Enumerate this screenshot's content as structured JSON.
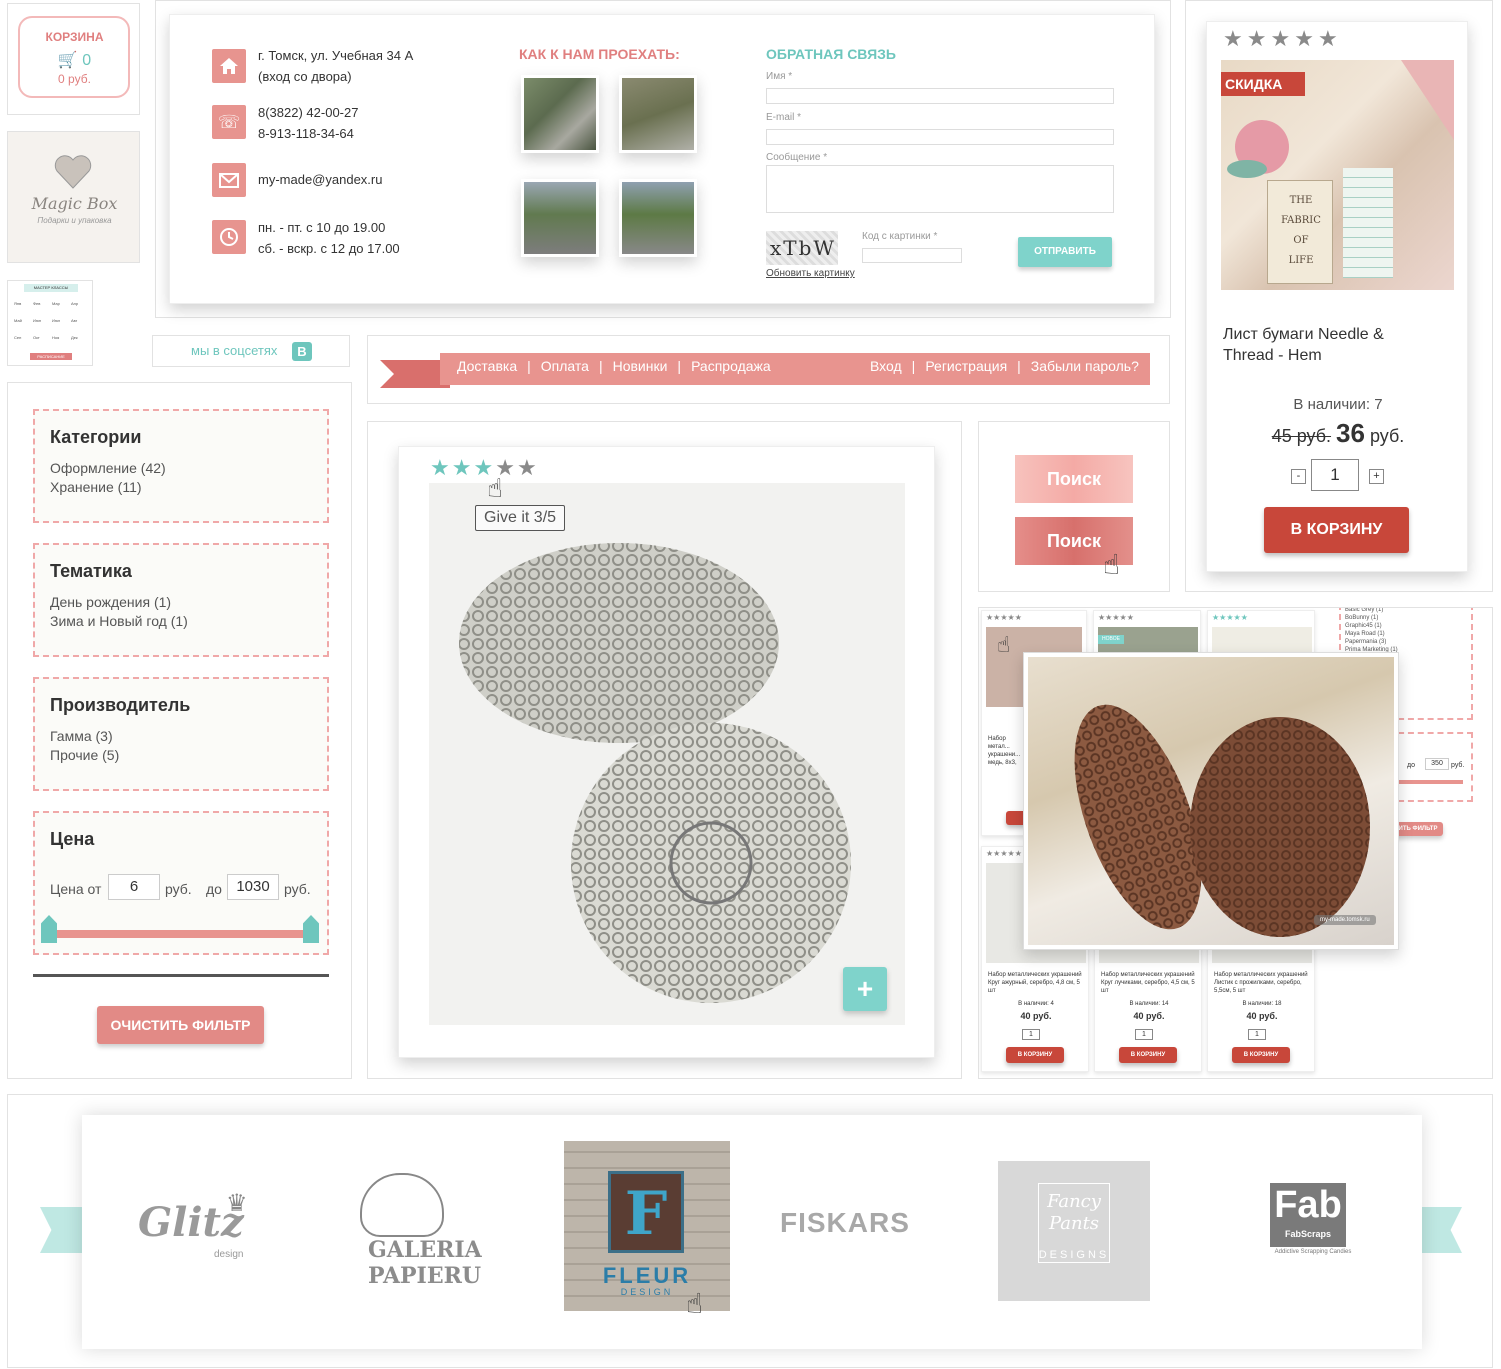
{
  "cart": {
    "title": "КОРЗИНА",
    "count": "0",
    "sum": "0 руб."
  },
  "logo": {
    "name": "Magic Box",
    "tagline": "Подарки и упаковка"
  },
  "schedule_thumb": {
    "title": "МАСТЕР КЛАССЫ",
    "months": [
      "Янв",
      "Фев",
      "Мар",
      "Апр",
      "Май",
      "Июн",
      "Июл",
      "Авг",
      "Сен",
      "Окт",
      "Ноя",
      "Дек"
    ],
    "button": "РАСПИСАНИЕ"
  },
  "contacts": {
    "address": [
      "г. Томск, ул. Учебная 34 А",
      "(вход со двора)"
    ],
    "phones": [
      "8(3822) 42-00-27",
      "8-913-118-34-64"
    ],
    "email": "my-made@yandex.ru",
    "hours": [
      "пн. - пт. с 10 до 19.00",
      "сб. - вскр. с 12 до 17.00"
    ],
    "icons": [
      "home-icon",
      "phone-icon",
      "mail-icon",
      "clock-icon"
    ]
  },
  "directions": {
    "title": "КАК К НАМ ПРОЕХАТЬ:"
  },
  "feedback": {
    "title": "ОБРАТНАЯ СВЯЗЬ",
    "name_label": "Имя *",
    "email_label": "E-mail *",
    "message_label": "Сообщение *",
    "captcha_text": "xTbW",
    "captcha_label": "Код с картинки *",
    "refresh_link": "Обновить картинку",
    "submit": "ОТПРАВИТЬ"
  },
  "social": {
    "label": "мы в соцсетях",
    "vk": "В"
  },
  "nav": {
    "left": [
      "Доставка",
      "Оплата",
      "Новинки",
      "Распродажа"
    ],
    "right": [
      "Вход",
      "Регистрация",
      "Забыли пароль?"
    ],
    "separator": "|"
  },
  "filters": {
    "categories": {
      "title": "Категории",
      "items": [
        "Оформление (42)",
        "Хранение (11)"
      ]
    },
    "themes": {
      "title": "Тематика",
      "items": [
        "День рождения (1)",
        "Зима и Новый год (1)"
      ]
    },
    "makers": {
      "title": "Производитель",
      "items": [
        "Гамма (3)",
        "Прочие (5)"
      ]
    },
    "price": {
      "title": "Цена",
      "from_label": "Цена от",
      "from": "6",
      "unit": "руб.",
      "to_label": "до",
      "to": "1030"
    },
    "clear": "ОЧИСТИТЬ ФИЛЬТР"
  },
  "rating_demo": {
    "tooltip": "Give it 3/5",
    "value": 3,
    "max": 5,
    "add": "+"
  },
  "search": {
    "label": "Поиск",
    "label_hover": "Поиск"
  },
  "product": {
    "badge": "СКИДКА",
    "name": "Лист бумаги Needle & Thread - Hem",
    "stock": "В наличии: 7",
    "old_price": "45 руб.",
    "price": "36",
    "unit": "руб.",
    "qty": "1",
    "minus": "-",
    "plus": "+",
    "buy": "В КОРЗИНУ",
    "paper_text": [
      "THE",
      "FABRIC",
      "OF",
      "LIFE"
    ],
    "rating": 0,
    "rating_max": 5
  },
  "grid": {
    "items": [
      {
        "name": "Набор металлических украшений Круг ажурный, серебро, 4,8 см, 5 шт",
        "stock": "В наличии: 4",
        "price": "40 руб."
      },
      {
        "name": "Набор металлических украшений Круг лучиками, серебро, 4,5 см, 5 шт",
        "stock": "В наличии: 14",
        "price": "40 руб."
      },
      {
        "name": "Набор металлических украшений Листик с прожилками, серебро, 5,5см, 5 шт",
        "stock": "В наличии: 18",
        "price": "40 руб."
      }
    ],
    "top_partial": "Набор метал... украшени... медь, 8х3,",
    "new_badge": "НОВОЕ",
    "qty": "1",
    "buy": "В КОРЗИНУ",
    "side_list": [
      "Basic Grey (1)",
      "BoBunny (1)",
      "Graphic45 (1)",
      "Maya Road (1)",
      "Papermania (3)",
      "Prima Marketing (1)"
    ],
    "side_price_to_label": "до",
    "side_price_to": "350",
    "side_price_unit": "руб.",
    "side_clear": "ИТЬ ФИЛЬТР",
    "watermark": "my-made.tomsk.ru"
  },
  "brands": {
    "items": [
      {
        "text": "Glitz",
        "sub": "design"
      },
      {
        "text": "GALERIA PAPIERU"
      },
      {
        "text": "FLEUR",
        "sub": "DESIGN"
      },
      {
        "text": "FISKARS"
      },
      {
        "text": "Fancy Pants",
        "sub": "DESIGNS"
      },
      {
        "text": "Fab",
        "sub": "FabScraps",
        "tagline": "Addictive Scrapping Candies"
      }
    ]
  },
  "colors": {
    "pink": "#e28a86",
    "teal": "#6ec6bd",
    "red": "#c8473a"
  }
}
